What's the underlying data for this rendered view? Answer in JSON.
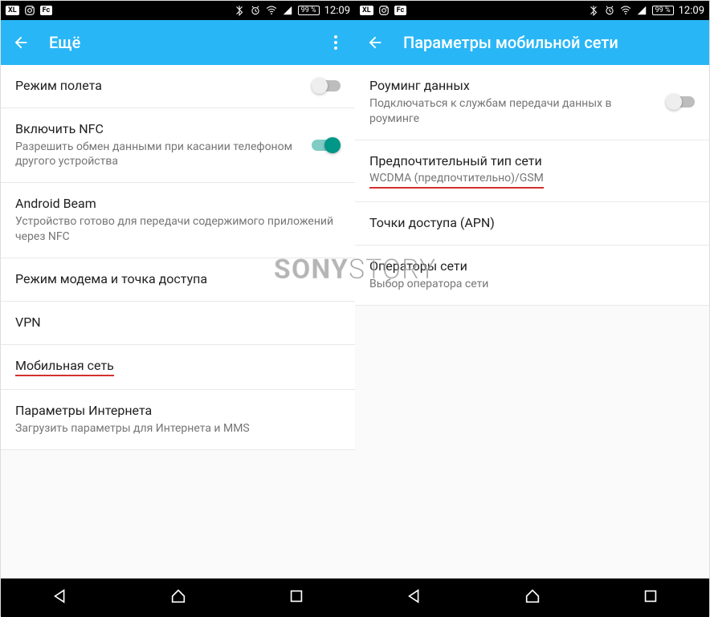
{
  "status": {
    "xl": "XL",
    "fc": "Fc",
    "battery": "99 %",
    "time": "12:09"
  },
  "left": {
    "title": "Ещё",
    "items": [
      {
        "title": "Режим полета",
        "sub": "",
        "switch": "off"
      },
      {
        "title": "Включить NFC",
        "sub": "Разрешить обмен данными при касании телефоном другого устройства",
        "switch": "on"
      },
      {
        "title": "Android Beam",
        "sub": "Устройство готово для передачи содержимого приложений через NFC"
      },
      {
        "title": "Режим модема и точка доступа",
        "sub": ""
      },
      {
        "title": "VPN",
        "sub": ""
      },
      {
        "title": "Мобильная сеть",
        "sub": "",
        "underline": true
      },
      {
        "title": "Параметры Интернета",
        "sub": "Загрузить параметры для Интернета и MMS"
      }
    ]
  },
  "right": {
    "title": "Параметры мобильной сети",
    "items": [
      {
        "title": "Роуминг данных",
        "sub": "Подключаться к службам передачи данных в роуминге",
        "switch": "off"
      },
      {
        "title": "Предпочтительный тип сети",
        "sub": "WCDMA (предпочтительно)/GSM",
        "underline_sub": true
      },
      {
        "title": "Точки доступа (APN)",
        "sub": ""
      },
      {
        "title": "Операторы сети",
        "sub": "Выбор оператора сети"
      }
    ]
  },
  "watermark": {
    "a": "SONY",
    "b": "STORY"
  }
}
